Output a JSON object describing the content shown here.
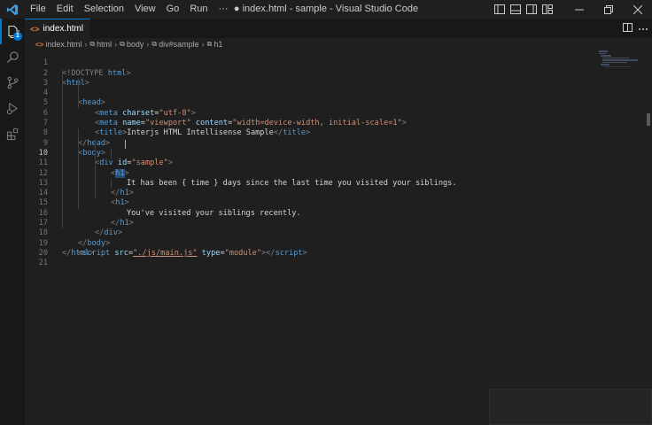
{
  "titlebar": {
    "window_title": "● index.html - sample - Visual Studio Code",
    "menu": [
      "File",
      "Edit",
      "Selection",
      "View",
      "Go",
      "Run",
      "···"
    ]
  },
  "activity": {
    "explorer_badge": "1"
  },
  "tab": {
    "label": "index.html",
    "icon": "<>"
  },
  "breadcrumb": {
    "items": [
      "index.html",
      "html",
      "body",
      "div#sample",
      "h1"
    ]
  },
  "editor": {
    "current_line": 10,
    "lines": [
      {
        "n": "1"
      },
      {
        "n": "2"
      },
      {
        "n": "3"
      },
      {
        "n": "4"
      },
      {
        "n": "5"
      },
      {
        "n": "6"
      },
      {
        "n": "7"
      },
      {
        "n": "8"
      },
      {
        "n": "9"
      },
      {
        "n": "10"
      },
      {
        "n": "11"
      },
      {
        "n": "12"
      },
      {
        "n": "13"
      },
      {
        "n": "14"
      },
      {
        "n": "15"
      },
      {
        "n": "16"
      },
      {
        "n": "17"
      },
      {
        "n": "18"
      },
      {
        "n": "19"
      },
      {
        "n": "20"
      },
      {
        "n": "21"
      }
    ],
    "code": {
      "l1": {
        "a": "<!DOCTYPE ",
        "b": "html",
        "c": ">"
      },
      "l2": {
        "a": "<",
        "b": "html",
        "c": ">"
      },
      "l3": {
        "a": "<",
        "b": "head",
        "c": ">"
      },
      "l4": {
        "a": "<",
        "b": "meta ",
        "attr": "charset",
        "eq": "=",
        "val": "\"utf-8\"",
        "c": ">"
      },
      "l5": {
        "a": "<",
        "b": "meta ",
        "attr1": "name",
        "eq1": "=",
        "val1": "\"viewport\"",
        "attr2": " content",
        "eq2": "=",
        "val2": "\"width=device-width, initial-scale=1\"",
        "c": ">"
      },
      "l6": {
        "a": "<",
        "b": "title",
        "c": ">",
        "text": "Interjs HTML Intellisense Sample",
        "d": "</",
        "e": "title",
        "f": ">"
      },
      "l7": {
        "a": "</",
        "b": "head",
        "c": ">"
      },
      "l8": {
        "a": "<",
        "b": "body",
        "c": ">"
      },
      "l9": {
        "a": "<",
        "b": "div ",
        "attr": "id",
        "eq": "=",
        "val": "\"sample\"",
        "c": ">"
      },
      "l10": {
        "a": "<",
        "b": "h1",
        "c": ">"
      },
      "l11": {
        "text": "It has been { time } days since the last time you visited your siblings."
      },
      "l12": {
        "a": "</",
        "b": "h1",
        "c": ">"
      },
      "l13": {
        "a": "<",
        "b": "h1",
        "c": ">"
      },
      "l14": {
        "text": "You've visited your siblings recently."
      },
      "l15": {
        "a": "</",
        "b": "h1",
        "c": ">"
      },
      "l16": {
        "a": "</",
        "b": "div",
        "c": ">"
      },
      "l17": {
        "a": "</",
        "b": "body",
        "c": ">"
      },
      "l18": {
        "a": "<",
        "b": "script ",
        "attr1": "src",
        "eq1": "=",
        "val1": "\"./js/main.js\"",
        "attr2": " type",
        "eq2": "=",
        "val2": "\"module\"",
        "c": "></",
        "d": "script",
        "e": ">"
      },
      "l19": {
        "a": "</",
        "b": "html",
        "c": ">"
      }
    }
  },
  "colors": {
    "accent": "#0078d4",
    "tag": "#569cd6",
    "attr": "#9cdcfe",
    "string": "#ce9178"
  }
}
